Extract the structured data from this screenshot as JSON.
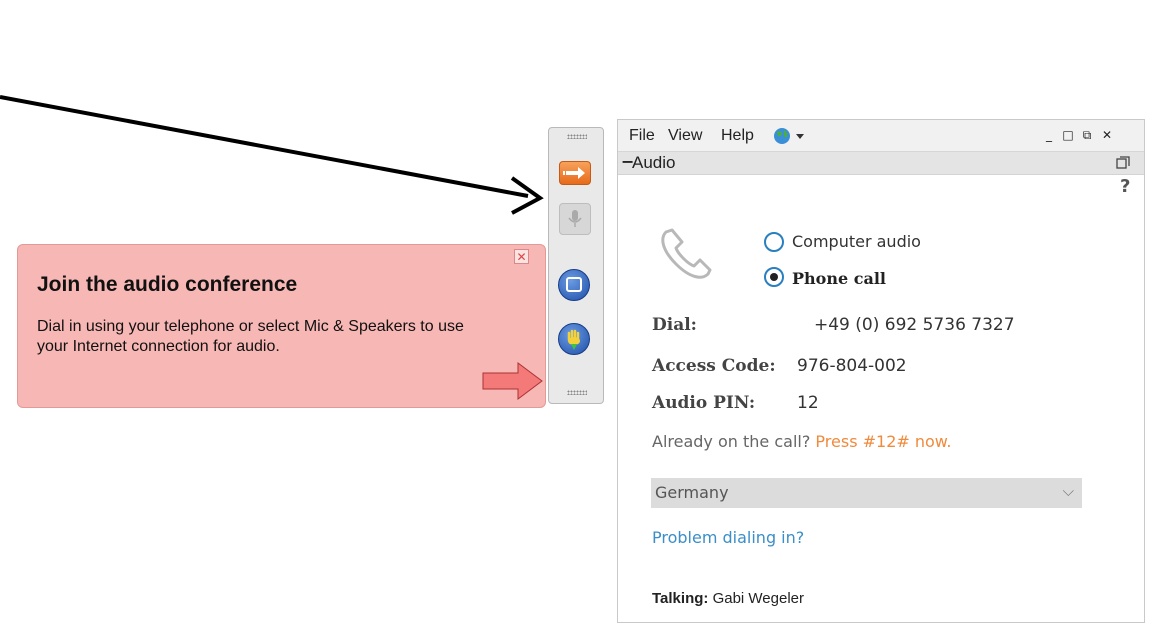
{
  "tooltip": {
    "title": "Join the audio conference",
    "body": "Dial in using your telephone or select Mic & Speakers to use your Internet connection for audio.",
    "close_glyph": "✕"
  },
  "menu": {
    "file": "File",
    "view": "View",
    "help": "Help",
    "globe_icon": "globe-icon",
    "window_buttons": [
      "_",
      "□",
      "⧉",
      "✕"
    ]
  },
  "audio": {
    "collapse": "−",
    "section_title": "Audio",
    "help": "?",
    "options": [
      {
        "label": "Computer audio",
        "selected": false
      },
      {
        "label": "Phone call",
        "selected": true
      }
    ],
    "dial_label": "Dial:",
    "dial_value": "+49 (0) 692 5736 7327",
    "access_label": "Access Code:",
    "access_value": "976-804-002",
    "pin_label": "Audio PIN:",
    "pin_value": "12",
    "already_prefix": "Already on the call?",
    "already_action": "Press #12# now.",
    "country": "Germany",
    "problem_link": "Problem dialing in?",
    "talking_label": "Talking:",
    "talking_name": "Gabi Wegeler"
  },
  "colors": {
    "tooltip_bg": "#f7b7b5",
    "accent_orange": "#f08a3c",
    "link_blue": "#3b8ec8",
    "radio_blue": "#2a7fbf"
  }
}
